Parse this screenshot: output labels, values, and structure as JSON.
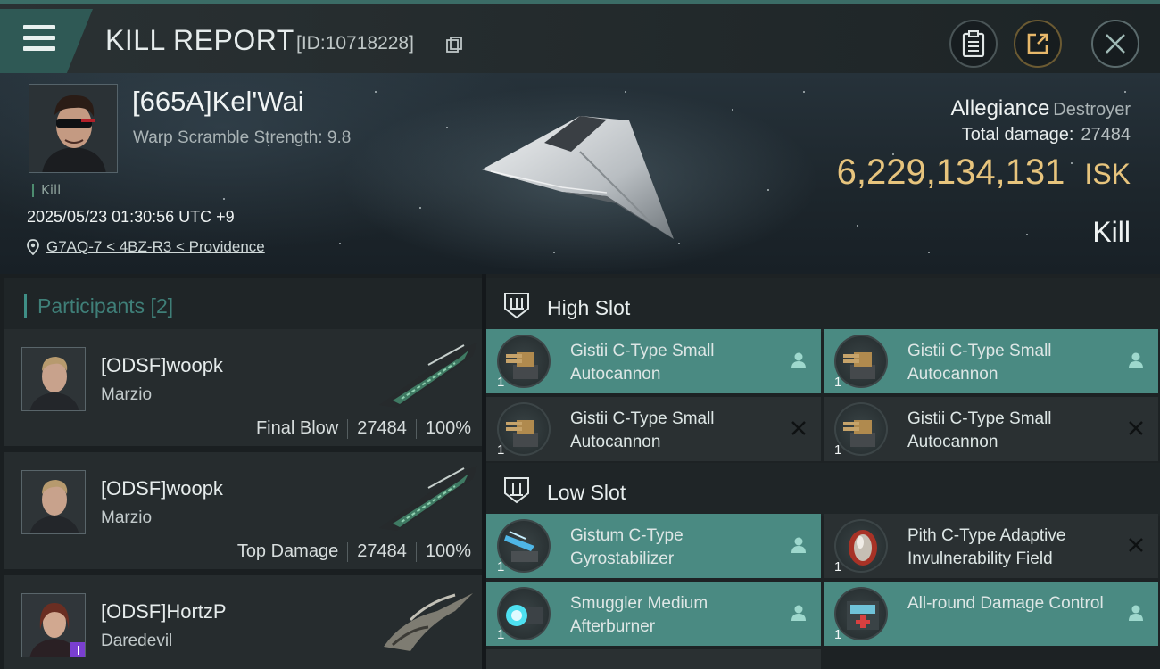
{
  "header": {
    "title": "KILL REPORT",
    "report_id": "[ID:10718228]"
  },
  "victim": {
    "name": "[665A]Kel'Wai",
    "warp_scramble": "Warp Scramble Strength: 9.8",
    "kill_tag": "Kill",
    "datetime": "2025/05/23 01:30:56 UTC +9",
    "location": "G7AQ-7 < 4BZ-R3 < Providence",
    "allegiance_label": "Allegiance",
    "allegiance_value": "Destroyer",
    "total_damage_label": "Total damage:",
    "total_damage_value": "27484",
    "isk_value": "6,229,134,131",
    "isk_unit": "ISK",
    "result": "Kill"
  },
  "participants": {
    "header": "Participants [2]",
    "items": [
      {
        "name": "[ODSF]woopk",
        "ship": "Marzio",
        "tag": "Final Blow",
        "damage": "27484",
        "percent": "100%"
      },
      {
        "name": "[ODSF]woopk",
        "ship": "Marzio",
        "tag": "Top Damage",
        "damage": "27484",
        "percent": "100%"
      },
      {
        "name": "[ODSF]HortzP",
        "ship": "Daredevil",
        "tag": "",
        "damage": "",
        "percent": ""
      }
    ]
  },
  "fitting": {
    "high_slot_label": "High Slot",
    "low_slot_label": "Low Slot",
    "high": [
      {
        "name": "Gistii C-Type Small Autocannon",
        "qty": "1",
        "status": "fitted",
        "icon": "autocannon-icon"
      },
      {
        "name": "Gistii C-Type Small Autocannon",
        "qty": "1",
        "status": "fitted",
        "icon": "autocannon-icon"
      },
      {
        "name": "Gistii C-Type Small Autocannon",
        "qty": "1",
        "status": "destroyed",
        "icon": "autocannon-icon"
      },
      {
        "name": "Gistii C-Type Small Autocannon",
        "qty": "1",
        "status": "destroyed",
        "icon": "autocannon-icon"
      }
    ],
    "low": [
      {
        "name": "Gistum C-Type Gyrostabilizer",
        "qty": "1",
        "status": "fitted",
        "icon": "gyrostabilizer-icon"
      },
      {
        "name": "Pith C-Type Adaptive Invulnerability Field",
        "qty": "1",
        "status": "destroyed",
        "icon": "shield-field-icon"
      },
      {
        "name": "Smuggler Medium Afterburner",
        "qty": "1",
        "status": "fitted",
        "icon": "afterburner-icon"
      },
      {
        "name": "All-round Damage Control",
        "qty": "1",
        "status": "fitted",
        "icon": "damage-control-icon"
      }
    ]
  },
  "colors": {
    "accent_teal": "#4a8a82",
    "isk_gold": "#e7c47d",
    "header_teal": "#2f5955"
  }
}
